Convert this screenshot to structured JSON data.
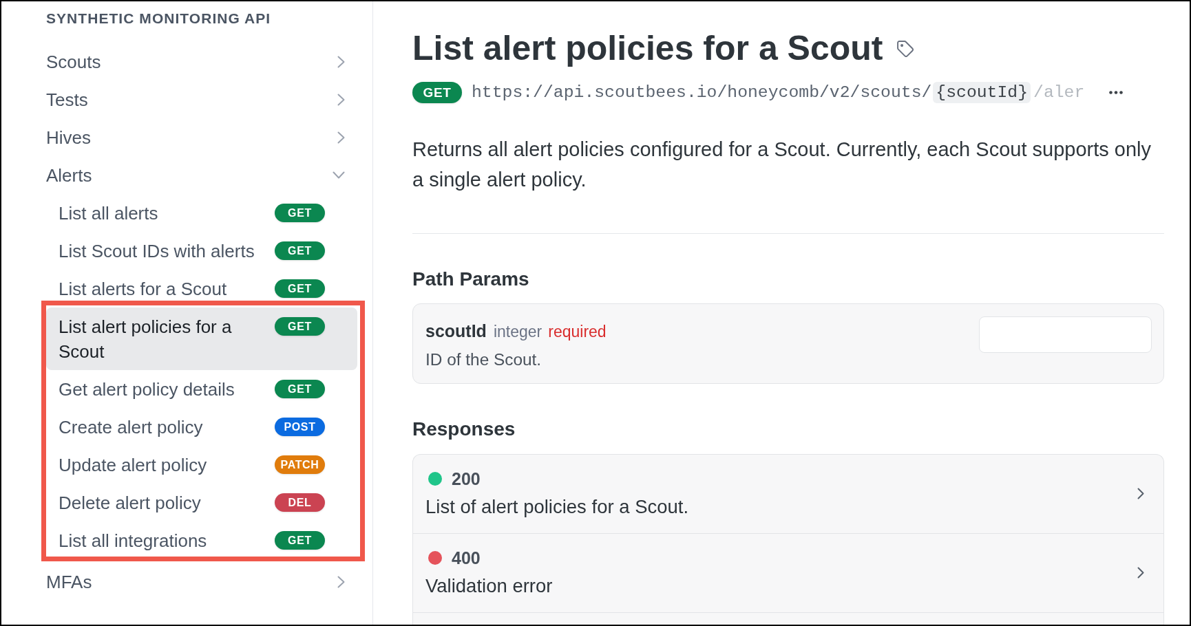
{
  "sidebar": {
    "title": "SYNTHETIC MONITORING API",
    "sections": [
      {
        "label": "Scouts",
        "expanded": false
      },
      {
        "label": "Tests",
        "expanded": false
      },
      {
        "label": "Hives",
        "expanded": false
      },
      {
        "label": "Alerts",
        "expanded": true,
        "children": [
          {
            "label": "List all alerts",
            "method": "GET",
            "color": "#0b8750",
            "selected": false
          },
          {
            "label": "List Scout IDs with alerts",
            "method": "GET",
            "color": "#0b8750",
            "selected": false
          },
          {
            "label": "List alerts for a Scout",
            "method": "GET",
            "color": "#0b8750",
            "selected": false
          }
        ],
        "highlighted_children": [
          {
            "label": "List alert policies for a Scout",
            "method": "GET",
            "color": "#0b8750",
            "selected": true
          },
          {
            "label": "Get alert policy details",
            "method": "GET",
            "color": "#0b8750",
            "selected": false
          },
          {
            "label": "Create alert policy",
            "method": "POST",
            "color": "#0b6be0",
            "selected": false
          },
          {
            "label": "Update alert policy",
            "method": "PATCH",
            "color": "#e07c0c",
            "selected": false
          },
          {
            "label": "Delete alert policy",
            "method": "DEL",
            "color": "#cb4352",
            "selected": false
          },
          {
            "label": "List all integrations",
            "method": "GET",
            "color": "#0b8750",
            "selected": false
          }
        ]
      },
      {
        "label": "MFAs",
        "expanded": false
      }
    ]
  },
  "page": {
    "title": "List alert policies for a Scout",
    "endpoint": {
      "method": "GET",
      "color": "#0b8750",
      "url_parts": [
        {
          "kind": "text",
          "text": "https://api.scoutbees.io/honeycomb/v2/scouts/"
        },
        {
          "kind": "param",
          "text": "{scoutId}"
        },
        {
          "kind": "faded",
          "text": "/aler"
        }
      ]
    },
    "description": "Returns all alert policies configured for a Scout. Currently, each Scout supports only a single alert policy.",
    "path_params": {
      "heading": "Path Params",
      "params": [
        {
          "name": "scoutId",
          "type": "integer",
          "requirement": "required",
          "description": "ID of the Scout."
        }
      ]
    },
    "responses": {
      "heading": "Responses",
      "items": [
        {
          "code": "200",
          "description": "List of alert policies for a Scout.",
          "color": "#20c58a"
        },
        {
          "code": "400",
          "description": "Validation error",
          "color": "#e5535b"
        }
      ]
    }
  }
}
